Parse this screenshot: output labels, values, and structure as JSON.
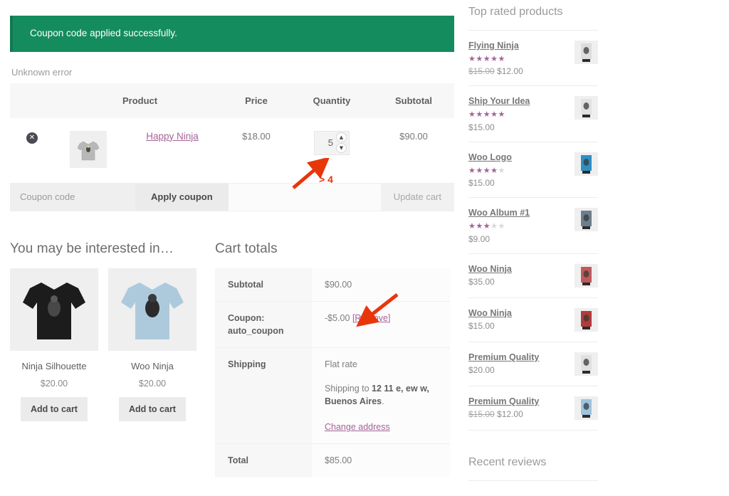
{
  "notice": {
    "message": "Coupon code applied successfully."
  },
  "error": {
    "message": "Unknown error"
  },
  "cart_table": {
    "headers": {
      "remove": "",
      "thumbnail": "",
      "product": "Product",
      "price": "Price",
      "quantity": "Quantity",
      "subtotal": "Subtotal"
    },
    "rows": [
      {
        "remove_icon": "remove-x-icon",
        "product_name": "Happy Ninja",
        "price": "$18.00",
        "quantity": "5",
        "subtotal": "$90.00"
      }
    ]
  },
  "coupon_row": {
    "input_value": "",
    "input_placeholder": "Coupon code",
    "apply_label": "Apply coupon",
    "update_label": "Update cart"
  },
  "upsells": {
    "title": "You may be interested in…",
    "items": [
      {
        "name": "Ninja Silhouette",
        "price": "$20.00",
        "button": "Add to cart",
        "shirt_color": "#1c1c1c"
      },
      {
        "name": "Woo Ninja",
        "price": "$20.00",
        "button": "Add to cart",
        "shirt_color": "#adcadd"
      }
    ]
  },
  "cart_totals": {
    "title": "Cart totals",
    "rows": {
      "subtotal_label": "Subtotal",
      "subtotal_value": "$90.00",
      "coupon_label": "Coupon: auto_coupon",
      "coupon_value": "-$5.00",
      "coupon_remove": "[Remove]",
      "shipping_label": "Shipping",
      "shipping_method": "Flat rate",
      "shipping_to_prefix": "Shipping to ",
      "shipping_address": "12 11 e, ew w, Buenos Aires",
      "shipping_to_suffix": ".",
      "change_address": "Change address",
      "total_label": "Total",
      "total_value": "$85.00"
    }
  },
  "sidebar": {
    "top_rated_title": "Top rated products",
    "recent_reviews_title": "Recent reviews",
    "products": [
      {
        "name": "Flying Ninja",
        "stars": 5,
        "old_price": "$15.00",
        "price": "$12.00",
        "thumb": "#dddddd"
      },
      {
        "name": "Ship Your Idea",
        "stars": 5,
        "old_price": "",
        "price": "$15.00",
        "thumb": "#e2e2e2"
      },
      {
        "name": "Woo Logo",
        "stars": 4,
        "old_price": "",
        "price": "$15.00",
        "thumb": "#2e8fc4"
      },
      {
        "name": "Woo Album #1",
        "stars": 3,
        "old_price": "",
        "price": "$9.00",
        "thumb": "#6d7f8c"
      },
      {
        "name": "Woo Ninja",
        "stars": 0,
        "old_price": "",
        "price": "$35.00",
        "thumb": "#c05a5a"
      },
      {
        "name": "Woo Ninja",
        "stars": 0,
        "old_price": "",
        "price": "$15.00",
        "thumb": "#b23b3b"
      },
      {
        "name": "Premium Quality",
        "stars": 0,
        "old_price": "",
        "price": "$20.00",
        "thumb": "#e0e0e0"
      },
      {
        "name": "Premium Quality",
        "stars": 0,
        "old_price": "$15.00",
        "price": "$12.00",
        "thumb": "#9ec4de"
      }
    ]
  },
  "annotations": {
    "quantity_note": "> 4",
    "arrow_color": "#e8360b"
  },
  "colors": {
    "notice_green": "#158c5e",
    "link_purple": "#a46497",
    "annotation_red": "#e8360b",
    "star_purple": "#a46497"
  }
}
